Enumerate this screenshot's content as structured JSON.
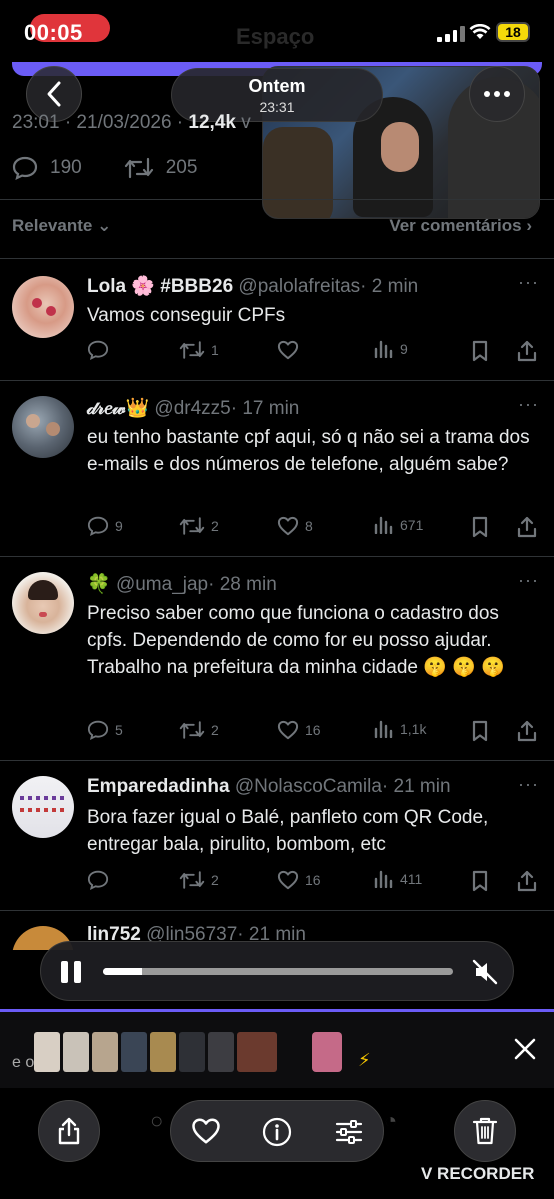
{
  "status_bar": {
    "time": "00:05",
    "ghost_title": "Espaço",
    "battery": "18"
  },
  "header": {
    "title": "Ontem",
    "subtitle": "23:31"
  },
  "post": {
    "meta": "23:01 · 21/03/2026 · ",
    "views": "12,4k",
    "views_suffix": " v",
    "replies": "190",
    "reposts": "205"
  },
  "sort": {
    "label": "Relevante",
    "see_comments": "Ver comentários"
  },
  "replies": [
    {
      "name": "Lola 🌸 #BBB26",
      "handle": "@palolafreitas",
      "time": "· 2 min",
      "text": "Vamos conseguir CPFs",
      "comments": "",
      "reposts": "1",
      "likes": "",
      "views": "9"
    },
    {
      "name": "𝒹𝓇𝑒𝓌👑",
      "handle": "@dr4zz5",
      "time": "· 17 min",
      "text": "eu tenho bastante cpf aqui, só q não sei a trama dos e-mails e dos números de telefone, alguém sabe?",
      "comments": "9",
      "reposts": "2",
      "likes": "8",
      "views": "671"
    },
    {
      "name": "🍀",
      "handle": "@uma_jap",
      "time": "· 28 min",
      "text": "Preciso saber como que funciona o cadastro dos cpfs.  Dependendo de como for eu posso ajudar. Trabalho na prefeitura da minha cidade 🤫 🤫 🤫",
      "comments": "5",
      "reposts": "2",
      "likes": "16",
      "views": "1,1k"
    },
    {
      "name": "Emparedadinha",
      "handle": "@NolascoCamila",
      "time": "· 21 min",
      "text": "Bora fazer igual o Balé, panfleto com QR Code, entregar bala, pirulito, bombom, etc",
      "comments": "",
      "reposts": "2",
      "likes": "16",
      "views": "411"
    },
    {
      "name": "lin752",
      "handle": "@lin56737",
      "time": "· 21 min",
      "text": "",
      "comments": "",
      "reposts": "",
      "likes": "",
      "views": ""
    }
  ],
  "player": {
    "progress": 0.11
  },
  "recorder": {
    "strip_label": "e o",
    "brand": "V RECORDER"
  },
  "colors": {
    "accent": "#6b5cf6",
    "recording": "#e0353b",
    "battery": "#f5d90a"
  }
}
